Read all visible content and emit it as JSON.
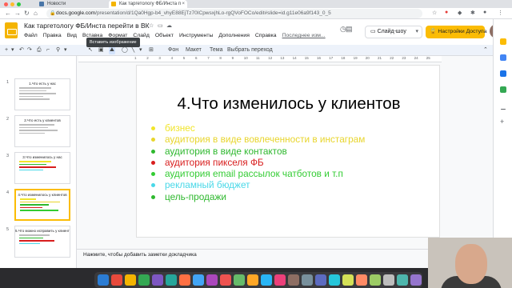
{
  "browser": {
    "tabs": [
      {
        "label": "Новости"
      },
      {
        "label": "Как таргетологу ФБ/Инста п",
        "close": "×"
      }
    ],
    "url_prefix": "docs.google.com",
    "url_rest": "/presentation/d/1Qa0Hgp-b4_vhyE88EjTz70ICpwsxjhLo-rgQVoFOCo/edit#slide=id.g11e06a9f143_0_5"
  },
  "header": {
    "title": "Как таргетологу ФБ/Инста перейти в ВК",
    "menu": [
      "Файл",
      "Правка",
      "Вид",
      "Вставка",
      "Формат",
      "Слайд",
      "Объект",
      "Инструменты",
      "Дополнения",
      "Справка",
      "Последнее изм..."
    ],
    "slideshow_label": "Слайд-шоу",
    "access_label": "Настройки Доступа"
  },
  "toolbar": {
    "items": {
      "bg": "Фон",
      "layout": "Макет",
      "theme": "Тема",
      "transition": "Выбрать переход"
    },
    "tooltip": "Вставить изображение"
  },
  "ruler": [
    "1",
    "2",
    "3",
    "4",
    "5",
    "6",
    "7",
    "8",
    "9",
    "10",
    "11",
    "12",
    "13",
    "14",
    "15",
    "16",
    "17",
    "18",
    "19",
    "20",
    "21",
    "22",
    "23",
    "24",
    "25"
  ],
  "filmstrip": [
    {
      "num": "1",
      "title": "1.Что есть у нас"
    },
    {
      "num": "2",
      "title": "2.Что есть у клиентов"
    },
    {
      "num": "3",
      "title": "3.Что изменилось у нас"
    },
    {
      "num": "4",
      "title": "4.Что изменилось у клиентов",
      "active": true
    },
    {
      "num": "5",
      "title": "5.Что можно исправить у клиентов"
    }
  ],
  "slide": {
    "title": "4.Что изменилось у клиентов",
    "bullets": [
      {
        "text": "бизнес",
        "color": "#f1e52a"
      },
      {
        "text": "аудитория в виде вовлеченности в инстаграм",
        "color": "#e8d52c"
      },
      {
        "text": "аудитория в виде контактов",
        "color": "#2eb82e"
      },
      {
        "text": "аудитория пикселя ФБ",
        "color": "#d81e1e"
      },
      {
        "text": "аудитория email рассылок чатботов и т.п",
        "color": "#33cc33"
      },
      {
        "text": "рекламный бюджет",
        "color": "#49d8e8"
      },
      {
        "text": "цель-продажи",
        "color": "#2eb82e"
      }
    ]
  },
  "notes": "Нажмите, чтобы добавить заметки докладчика"
}
